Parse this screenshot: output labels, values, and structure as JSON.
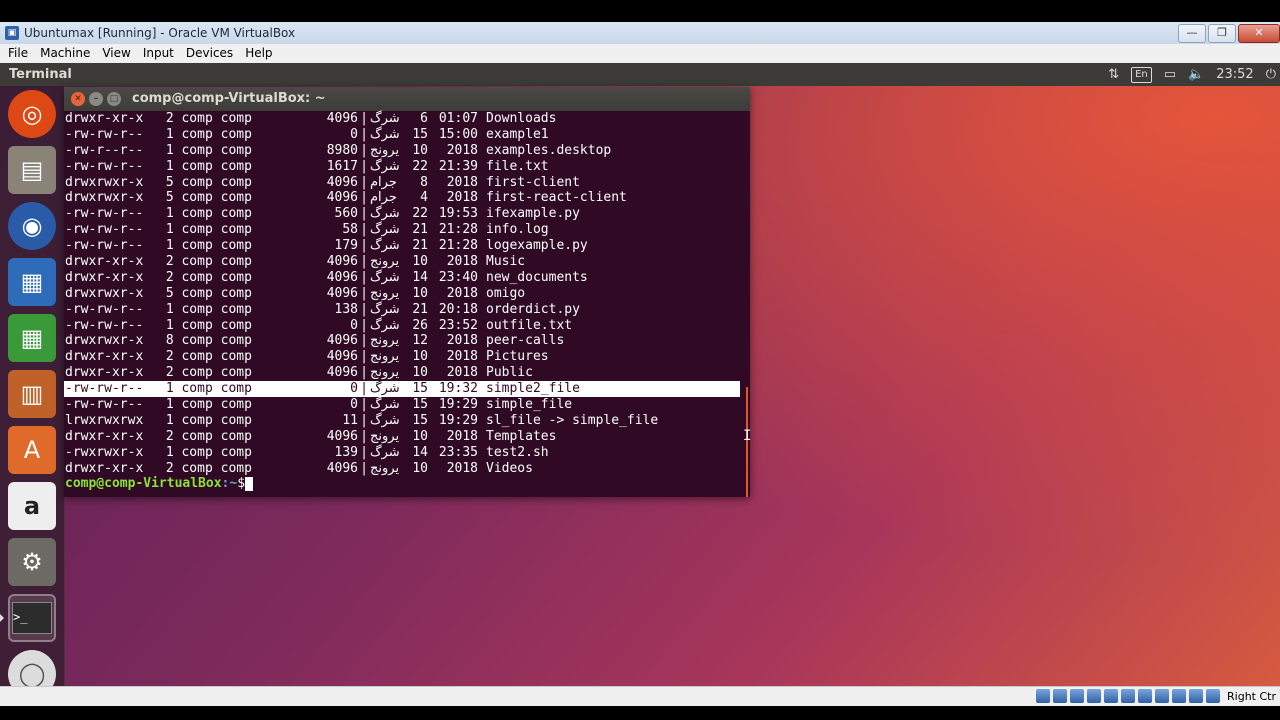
{
  "vbox": {
    "title": "Ubuntumax [Running] - Oracle VM VirtualBox",
    "menu": [
      "File",
      "Machine",
      "View",
      "Input",
      "Devices",
      "Help"
    ],
    "host_key": "Right Ctr"
  },
  "ubuntu": {
    "active_app": "Terminal",
    "keyboard_layout": "En",
    "clock": "23:52"
  },
  "terminal": {
    "title": "comp@comp-VirtualBox: ~",
    "lines": [
      {
        "perm": "drwxr-xr-x",
        "links": "2",
        "owner": "comp",
        "group": "comp",
        "size": "4096",
        "month": "شرگ",
        "day": "6",
        "time": "01:07",
        "name": "Downloads"
      },
      {
        "perm": "-rw-rw-r--",
        "links": "1",
        "owner": "comp",
        "group": "comp",
        "size": "0",
        "month": "شرگ",
        "day": "15",
        "time": "15:00",
        "name": "example1"
      },
      {
        "perm": "-rw-r--r--",
        "links": "1",
        "owner": "comp",
        "group": "comp",
        "size": "8980",
        "month": "يرونج",
        "day": "10",
        "time": "2018",
        "name": "examples.desktop"
      },
      {
        "perm": "-rw-rw-r--",
        "links": "1",
        "owner": "comp",
        "group": "comp",
        "size": "1617",
        "month": "شرگ",
        "day": "22",
        "time": "21:39",
        "name": "file.txt"
      },
      {
        "perm": "drwxrwxr-x",
        "links": "5",
        "owner": "comp",
        "group": "comp",
        "size": "4096",
        "month": "جرام",
        "day": "8",
        "time": "2018",
        "name": "first-client"
      },
      {
        "perm": "drwxrwxr-x",
        "links": "5",
        "owner": "comp",
        "group": "comp",
        "size": "4096",
        "month": "جرام",
        "day": "4",
        "time": "2018",
        "name": "first-react-client"
      },
      {
        "perm": "-rw-rw-r--",
        "links": "1",
        "owner": "comp",
        "group": "comp",
        "size": "560",
        "month": "شرگ",
        "day": "22",
        "time": "19:53",
        "name": "ifexample.py"
      },
      {
        "perm": "-rw-rw-r--",
        "links": "1",
        "owner": "comp",
        "group": "comp",
        "size": "58",
        "month": "شرگ",
        "day": "21",
        "time": "21:28",
        "name": "info.log"
      },
      {
        "perm": "-rw-rw-r--",
        "links": "1",
        "owner": "comp",
        "group": "comp",
        "size": "179",
        "month": "شرگ",
        "day": "21",
        "time": "21:28",
        "name": "logexample.py"
      },
      {
        "perm": "drwxr-xr-x",
        "links": "2",
        "owner": "comp",
        "group": "comp",
        "size": "4096",
        "month": "يرونج",
        "day": "10",
        "time": "2018",
        "name": "Music"
      },
      {
        "perm": "drwxr-xr-x",
        "links": "2",
        "owner": "comp",
        "group": "comp",
        "size": "4096",
        "month": "شرگ",
        "day": "14",
        "time": "23:40",
        "name": "new_documents"
      },
      {
        "perm": "drwxrwxr-x",
        "links": "5",
        "owner": "comp",
        "group": "comp",
        "size": "4096",
        "month": "يرونج",
        "day": "10",
        "time": "2018",
        "name": "omigo"
      },
      {
        "perm": "-rw-rw-r--",
        "links": "1",
        "owner": "comp",
        "group": "comp",
        "size": "138",
        "month": "شرگ",
        "day": "21",
        "time": "20:18",
        "name": "orderdict.py"
      },
      {
        "perm": "-rw-rw-r--",
        "links": "1",
        "owner": "comp",
        "group": "comp",
        "size": "0",
        "month": "شرگ",
        "day": "26",
        "time": "23:52",
        "name": "outfile.txt"
      },
      {
        "perm": "drwxrwxr-x",
        "links": "8",
        "owner": "comp",
        "group": "comp",
        "size": "4096",
        "month": "يرونج",
        "day": "12",
        "time": "2018",
        "name": "peer-calls"
      },
      {
        "perm": "drwxr-xr-x",
        "links": "2",
        "owner": "comp",
        "group": "comp",
        "size": "4096",
        "month": "يرونج",
        "day": "10",
        "time": "2018",
        "name": "Pictures"
      },
      {
        "perm": "drwxr-xr-x",
        "links": "2",
        "owner": "comp",
        "group": "comp",
        "size": "4096",
        "month": "يرونج",
        "day": "10",
        "time": "2018",
        "name": "Public"
      },
      {
        "perm": "-rw-rw-r--",
        "links": "1",
        "owner": "comp",
        "group": "comp",
        "size": "0",
        "month": "شرگ",
        "day": "15",
        "time": "19:32",
        "name": "simple2_file",
        "selected": true
      },
      {
        "perm": "-rw-rw-r--",
        "links": "1",
        "owner": "comp",
        "group": "comp",
        "size": "0",
        "month": "شرگ",
        "day": "15",
        "time": "19:29",
        "name": "simple_file"
      },
      {
        "perm": "lrwxrwxrwx",
        "links": "1",
        "owner": "comp",
        "group": "comp",
        "size": "11",
        "month": "شرگ",
        "day": "15",
        "time": "19:29",
        "name": "sl_file -> simple_file"
      },
      {
        "perm": "drwxr-xr-x",
        "links": "2",
        "owner": "comp",
        "group": "comp",
        "size": "4096",
        "month": "يرونج",
        "day": "10",
        "time": "2018",
        "name": "Templates"
      },
      {
        "perm": "-rwxrwxr-x",
        "links": "1",
        "owner": "comp",
        "group": "comp",
        "size": "139",
        "month": "شرگ",
        "day": "14",
        "time": "23:35",
        "name": "test2.sh"
      },
      {
        "perm": "drwxr-xr-x",
        "links": "2",
        "owner": "comp",
        "group": "comp",
        "size": "4096",
        "month": "يرونج",
        "day": "10",
        "time": "2018",
        "name": "Videos"
      }
    ],
    "prompt_user": "comp@comp-VirtualBox",
    "prompt_path": ":~",
    "prompt_symbol": "$"
  },
  "launcher": [
    "ubuntu-logo-icon",
    "files-icon",
    "firefox-icon",
    "writer-icon",
    "calc-icon",
    "impress-icon",
    "software-center-icon",
    "amazon-icon",
    "system-settings-icon",
    "terminal-icon",
    "dvd-icon"
  ]
}
